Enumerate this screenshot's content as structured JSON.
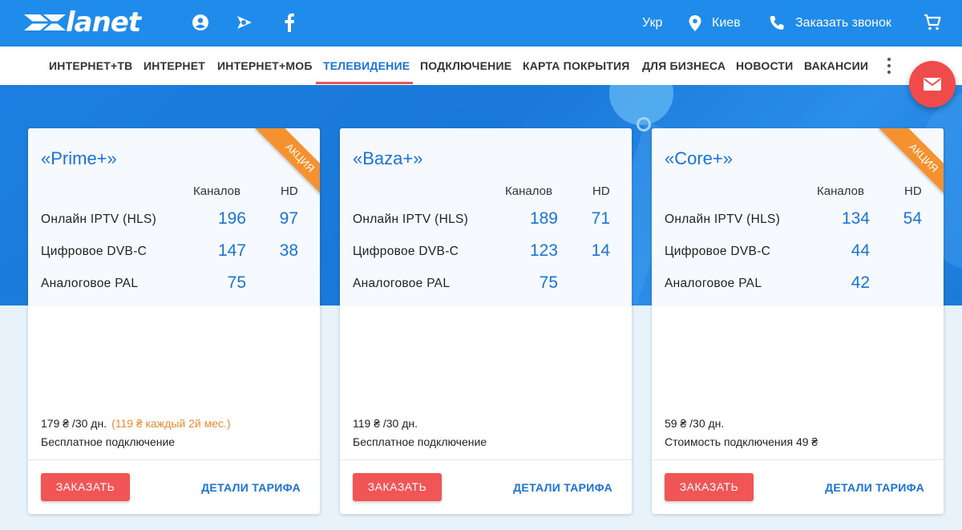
{
  "header": {
    "logo_text": "lanet",
    "language": "Укр",
    "city": "Киев",
    "callback": "Заказать звонок"
  },
  "nav": [
    {
      "label": "ИНТЕРНЕТ+ТВ"
    },
    {
      "label": "ИНТЕРНЕТ"
    },
    {
      "label": "ИНТЕРНЕТ+МОБ"
    },
    {
      "label": "ТЕЛЕВИДЕНИЕ",
      "active": true
    },
    {
      "label": "ПОДКЛЮЧЕНИЕ"
    },
    {
      "label": "КАРТА ПОКРЫТИЯ"
    },
    {
      "label": "ДЛЯ БИЗНЕСА"
    },
    {
      "label": "НОВОСТИ"
    },
    {
      "label": "ВАКАНСИИ"
    }
  ],
  "table_headers": {
    "channels": "Каналов",
    "hd": "HD"
  },
  "row_labels": {
    "iptv": "Онлайн IPTV (HLS)",
    "dvbc": "Цифровое DVB-C",
    "pal": "Аналоговое PAL"
  },
  "buttons": {
    "order": "ЗАКАЗАТЬ",
    "details": "ДЕТАЛИ ТАРИФА"
  },
  "tariffs": [
    {
      "title": "«Prime+»",
      "ribbon": "АКЦИЯ",
      "iptv_channels": "196",
      "iptv_hd": "97",
      "dvbc_channels": "147",
      "dvbc_hd": "38",
      "pal_channels": "75",
      "price": "179 ₴ /30 дн.",
      "promo": "(119 ₴ каждый 2й мес.)",
      "connection": "Бесплатное подключение"
    },
    {
      "title": "«Baza+»",
      "iptv_channels": "189",
      "iptv_hd": "71",
      "dvbc_channels": "123",
      "dvbc_hd": "14",
      "pal_channels": "75",
      "price": "119 ₴ /30 дн.",
      "connection": "Бесплатное подключение"
    },
    {
      "title": "«Core+»",
      "ribbon": "АКЦИЯ",
      "iptv_channels": "134",
      "iptv_hd": "54",
      "dvbc_channels": "44",
      "pal_channels": "42",
      "price": "59 ₴ /30 дн.",
      "connection": "Стоимость подключения 49 ₴"
    }
  ]
}
